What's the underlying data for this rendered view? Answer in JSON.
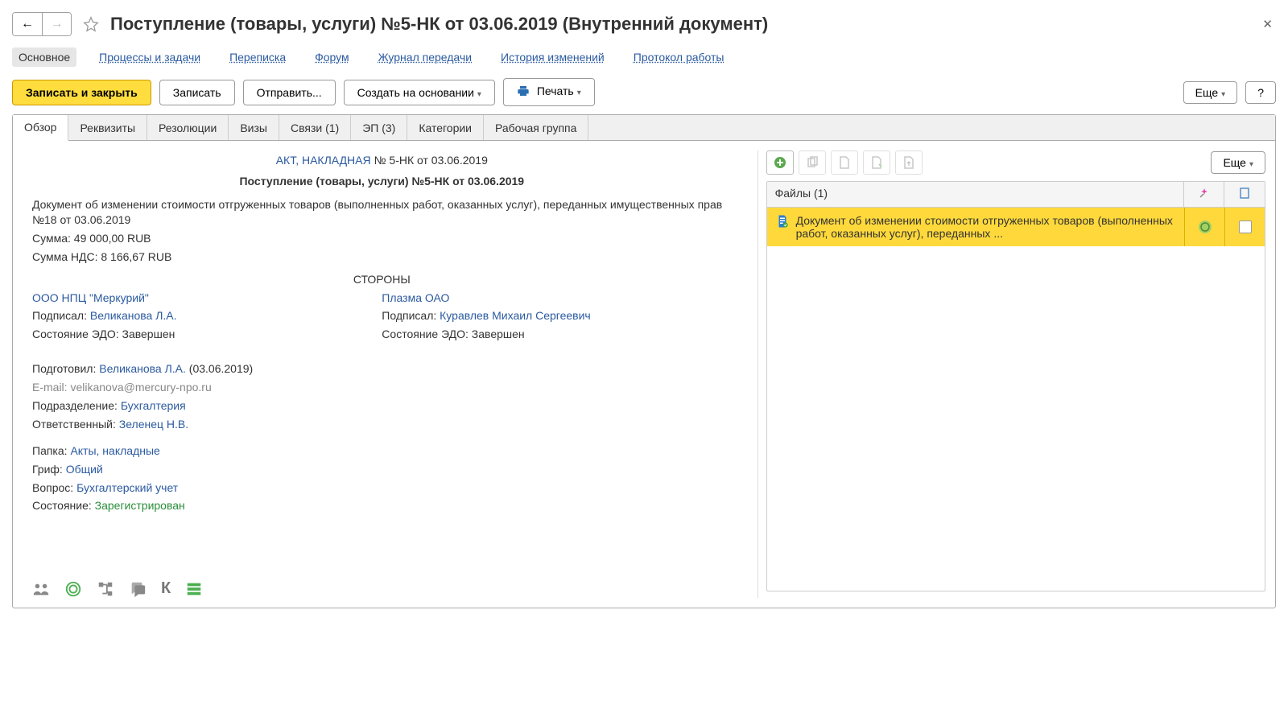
{
  "header": {
    "title": "Поступление (товары, услуги) №5-НК от 03.06.2019 (Внутренний документ)"
  },
  "nav": {
    "main": "Основное",
    "processes": "Процессы и задачи",
    "correspondence": "Переписка",
    "forum": "Форум",
    "transfer_log": "Журнал передачи",
    "history": "История изменений",
    "protocol": "Протокол работы"
  },
  "toolbar": {
    "save_close": "Записать и закрыть",
    "save": "Записать",
    "send": "Отправить...",
    "create_based": "Создать на основании",
    "print": "Печать",
    "more": "Еще",
    "help": "?"
  },
  "tabs": {
    "overview": "Обзор",
    "details": "Реквизиты",
    "resolutions": "Резолюции",
    "visas": "Визы",
    "links": "Связи (1)",
    "ep": "ЭП (3)",
    "categories": "Категории",
    "workgroup": "Рабочая группа"
  },
  "doc": {
    "type_label": "АКТ, НАКЛАДНАЯ",
    "number_suffix": " № 5-НК от 03.06.2019",
    "title": "Поступление (товары, услуги) №5-НК от 03.06.2019",
    "description": "Документ об изменении стоимости отгруженных товаров (выполненных работ, оказанных услуг), переданных имущественных прав №18 от 03.06.2019",
    "sum_label": "Сумма: ",
    "sum_value": "49 000,00 RUB",
    "vat_label": "Сумма НДС: ",
    "vat_value": "8 166,67 RUB",
    "parties_title": "СТОРОНЫ",
    "party1": {
      "org": "ООО НПЦ \"Меркурий\"",
      "signed_label": "Подписал: ",
      "signed": "Великанова Л.А.",
      "edo_label": "Состояние ЭДО: ",
      "edo": "Завершен"
    },
    "party2": {
      "org": "Плазма ОАО",
      "signed_label": "Подписал: ",
      "signed": "Куравлев Михаил Сергеевич",
      "edo_label": "Состояние ЭДО: ",
      "edo": "Завершен"
    },
    "prepared_label": "Подготовил: ",
    "prepared": "Великанова Л.А.",
    "prepared_date": " (03.06.2019)",
    "email_label": "E-mail: ",
    "email": "velikanova@mercury-npo.ru",
    "dept_label": "Подразделение: ",
    "dept": "Бухгалтерия",
    "resp_label": "Ответственный: ",
    "resp": "Зеленец Н.В.",
    "folder_label": "Папка: ",
    "folder": "Акты, накладные",
    "grif_label": "Гриф: ",
    "grif": "Общий",
    "question_label": "Вопрос: ",
    "question": "Бухгалтерский учет",
    "state_label": "Состояние: ",
    "state": "Зарегистрирован"
  },
  "files": {
    "more": "Еще",
    "header": "Файлы (1)",
    "row1_text": "Документ об изменении стоимости отгруженных товаров (выполненных работ, оказанных услуг), переданных ..."
  }
}
